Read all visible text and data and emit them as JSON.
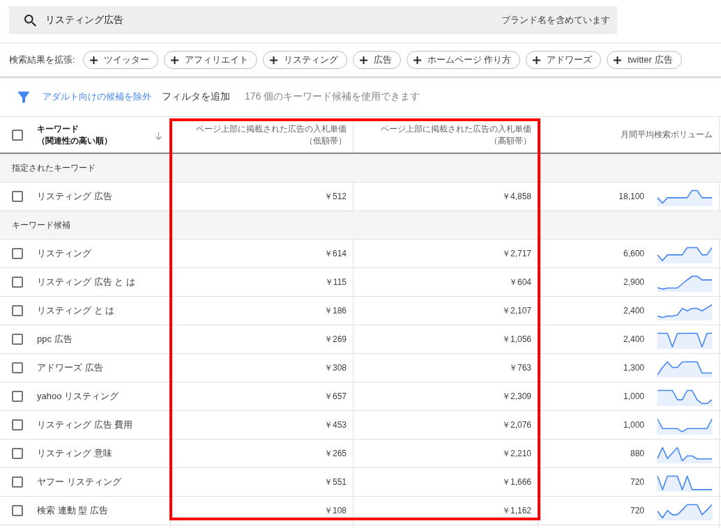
{
  "search": {
    "value": "リスティング広告",
    "brand_filter": "ブランド名を含めています"
  },
  "expand": {
    "label": "検索結果を拡張:",
    "chips": [
      "ツイッター",
      "アフィリエイト",
      "リスティング",
      "広告",
      "ホームページ 作り方",
      "アドワーズ",
      "twitter 広告"
    ]
  },
  "filters": {
    "exclude_link": "アダルト向けの候補を除外",
    "add_filter": "フィルタを追加",
    "result_count": "176 個のキーワード候補を使用できます"
  },
  "table": {
    "select_all": {
      "checked": false
    },
    "columns": [
      {
        "label": "キーワード",
        "sublabel": "（関連性の高い順）",
        "sorted": true,
        "highlighted": false
      },
      {
        "label": "ページ上部に掲載された広告の入札単価",
        "sublabel": "（低額帯）",
        "sorted": false,
        "highlighted": true
      },
      {
        "label": "ページ上部に掲載された広告の入札単価",
        "sublabel": "（高額帯）",
        "sorted": false,
        "highlighted": true
      },
      {
        "label": "月間平均検索ボリューム",
        "sorted": false,
        "highlighted": false
      }
    ],
    "sections": [
      {
        "title": "指定されたキーワード",
        "rows": [
          {
            "keyword": "リスティング 広告",
            "top_bid_low": "￥512",
            "top_bid_high": "￥4,858",
            "avg_monthly_searches": "18,100",
            "checked": false
          }
        ]
      },
      {
        "title": "キーワード候補",
        "rows": [
          {
            "keyword": "リスティング",
            "top_bid_low": "￥614",
            "top_bid_high": "￥2,717",
            "avg_monthly_searches": "6,600",
            "checked": false
          },
          {
            "keyword": "リスティング 広告 と は",
            "top_bid_low": "￥115",
            "top_bid_high": "￥604",
            "avg_monthly_searches": "2,900",
            "checked": false
          },
          {
            "keyword": "リスティング と は",
            "top_bid_low": "￥186",
            "top_bid_high": "￥2,107",
            "avg_monthly_searches": "2,400",
            "checked": false
          },
          {
            "keyword": "ppc 広告",
            "top_bid_low": "￥269",
            "top_bid_high": "￥1,056",
            "avg_monthly_searches": "2,400",
            "checked": false
          },
          {
            "keyword": "アドワーズ 広告",
            "top_bid_low": "￥308",
            "top_bid_high": "￥763",
            "avg_monthly_searches": "1,300",
            "checked": false
          },
          {
            "keyword": "yahoo リスティング",
            "top_bid_low": "￥657",
            "top_bid_high": "￥2,309",
            "avg_monthly_searches": "1,000",
            "checked": false
          },
          {
            "keyword": "リスティング 広告 費用",
            "top_bid_low": "￥453",
            "top_bid_high": "￥2,076",
            "avg_monthly_searches": "1,000",
            "checked": false
          },
          {
            "keyword": "リスティング 意味",
            "top_bid_low": "￥265",
            "top_bid_high": "￥2,210",
            "avg_monthly_searches": "880",
            "checked": false
          },
          {
            "keyword": "ヤフー リスティング",
            "top_bid_low": "￥551",
            "top_bid_high": "￥1,666",
            "avg_monthly_searches": "720",
            "checked": false
          },
          {
            "keyword": "検索 連動 型 広告",
            "top_bid_low": "￥108",
            "top_bid_high": "￥1,162",
            "avg_monthly_searches": "720",
            "checked": false
          }
        ]
      }
    ]
  }
}
